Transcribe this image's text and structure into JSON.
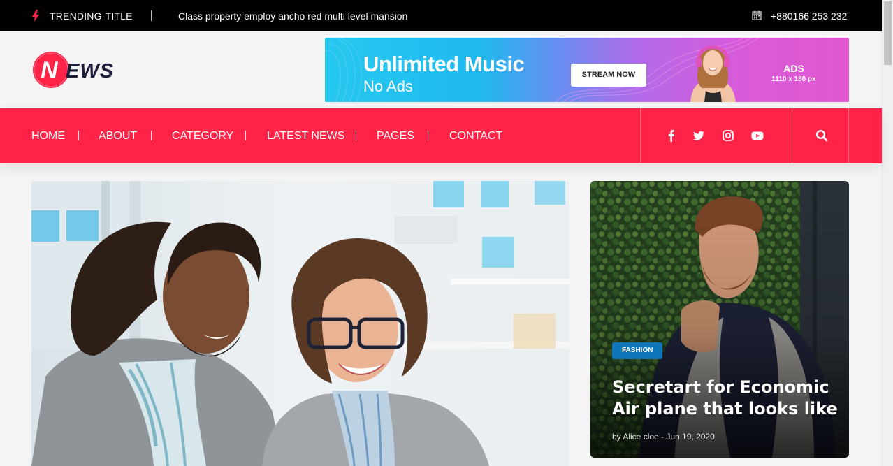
{
  "topbar": {
    "trending_label": "TRENDING-TITLE",
    "trending_text": "Class property employ ancho red multi level mansion",
    "phone": "+880166 253 232"
  },
  "header": {
    "logo_text": "NEWS",
    "ad": {
      "title": "Unlimited Music",
      "subtitle": "No Ads",
      "button": "STREAM NOW",
      "label": "ADS",
      "size": "1110 x 180 px"
    }
  },
  "nav": {
    "items": [
      "HOME",
      "ABOUT",
      "CATEGORY",
      "LATEST NEWS",
      "PAGES",
      "CONTACT"
    ],
    "social": [
      "facebook-icon",
      "twitter-icon",
      "instagram-icon",
      "youtube-icon"
    ],
    "search_icon": "search-icon"
  },
  "featured": {
    "category": "FASHION",
    "title": "Secretart for Economic Air plane that looks like",
    "meta": "by Alice cloe - Jun 19, 2020"
  },
  "colors": {
    "accent": "#ff2348",
    "badge": "#0f74b8",
    "topbar": "#000000"
  }
}
